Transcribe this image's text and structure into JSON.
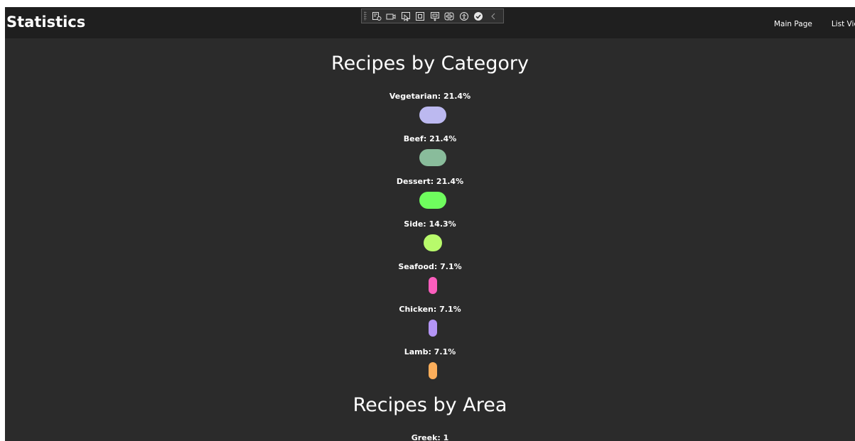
{
  "app": {
    "title": "Statistics"
  },
  "nav": {
    "items": [
      "Main Page",
      "List View"
    ]
  },
  "dev_toolbar": {
    "icons": [
      "live-visual-tree-icon",
      "screen-recorder-icon",
      "select-element-icon",
      "display-layout-adorners-icon",
      "track-focus-icon",
      "binding-failures-icon",
      "accessibility-icon",
      "hot-reload-status-icon",
      "collapse-toolbar-icon"
    ]
  },
  "sections": {
    "category": {
      "title": "Recipes by Category",
      "items": [
        {
          "name": "Vegetarian",
          "percent": 21.4,
          "label": "Vegetarian: 21.4%",
          "color": "#bcb9f0"
        },
        {
          "name": "Beef",
          "percent": 21.4,
          "label": "Beef: 21.4%",
          "color": "#89bc9b"
        },
        {
          "name": "Dessert",
          "percent": 21.4,
          "label": "Dessert: 21.4%",
          "color": "#6ffc5e"
        },
        {
          "name": "Side",
          "percent": 14.3,
          "label": "Side: 14.3%",
          "color": "#b8fa6b"
        },
        {
          "name": "Seafood",
          "percent": 7.1,
          "label": "Seafood: 7.1%",
          "color": "#fb5ebd"
        },
        {
          "name": "Chicken",
          "percent": 7.1,
          "label": "Chicken: 7.1%",
          "color": "#b495f6"
        },
        {
          "name": "Lamb",
          "percent": 7.1,
          "label": "Lamb: 7.1%",
          "color": "#fcae5b"
        }
      ]
    },
    "area": {
      "title": "Recipes by Area",
      "items": [
        {
          "name": "Greek",
          "count": 1,
          "label": "Greek: 1"
        }
      ]
    }
  }
}
